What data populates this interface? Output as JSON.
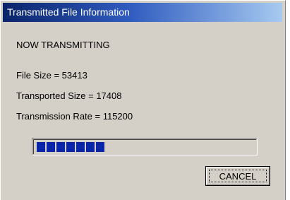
{
  "window": {
    "title": "Transmitted File Information"
  },
  "status": {
    "heading": "NOW TRANSMITTING",
    "file_size": "File Size = 53413",
    "transported_size": "Transported Size = 17408",
    "transmission_rate": "Transmission Rate = 115200"
  },
  "progress": {
    "value": 0.33
  },
  "buttons": {
    "cancel_label": "CANCEL"
  },
  "colors": {
    "title_bar_start": "#0a246a",
    "title_bar_end": "#a6caf0",
    "progress_block": "#0a24aa",
    "dialog_face": "#d4d0c8"
  }
}
